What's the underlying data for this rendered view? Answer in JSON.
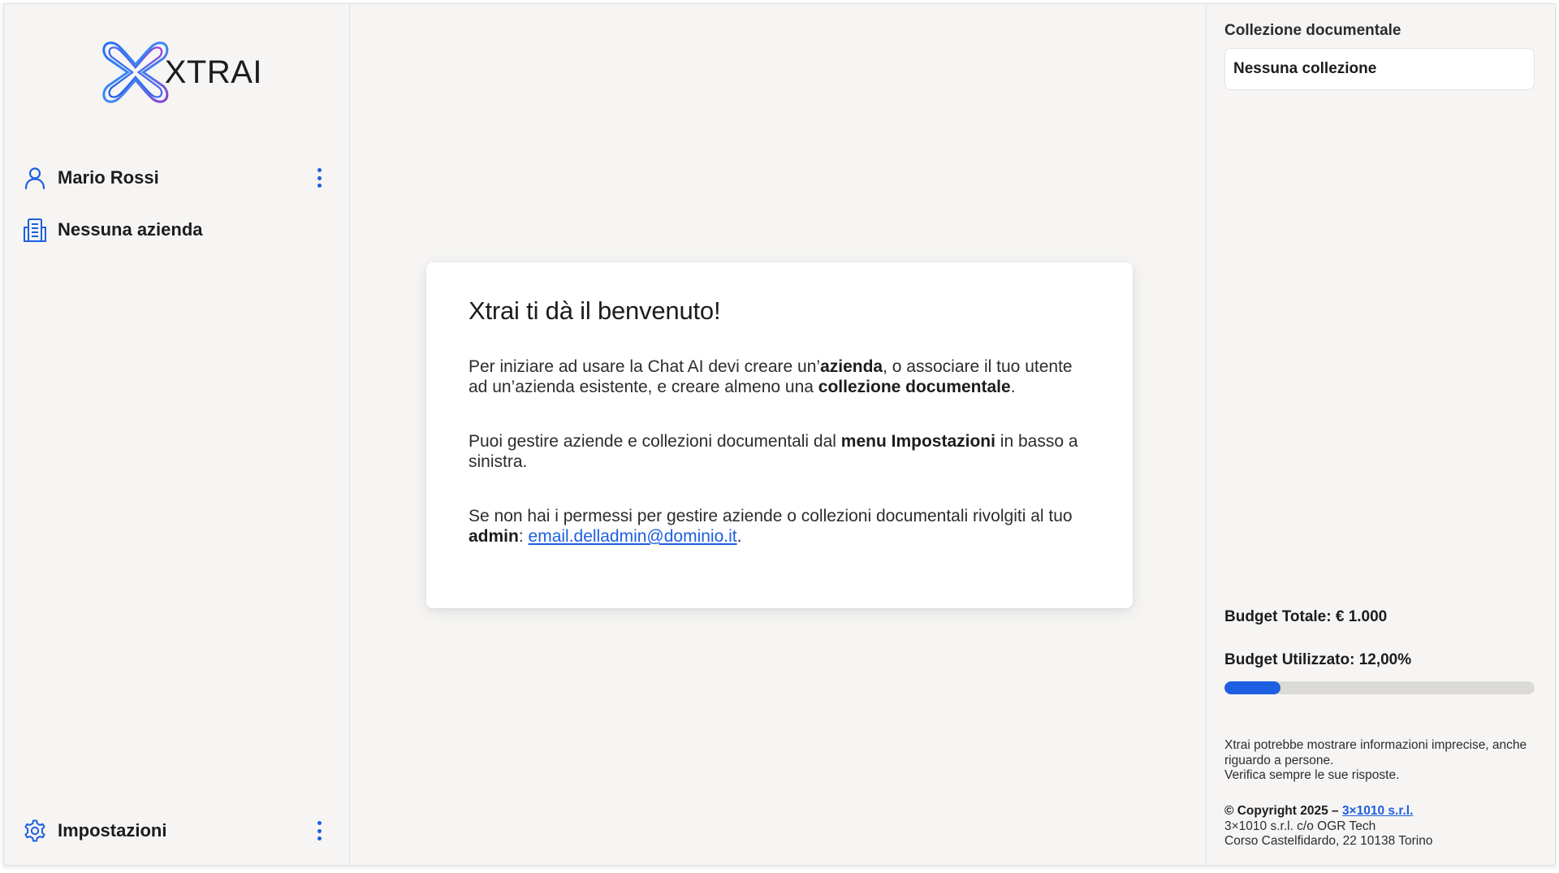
{
  "brand": {
    "logo_text": "XTRAI",
    "accent": "#1d5fe0",
    "logo_gradient": [
      "#2b6ef0",
      "#7a3fd0"
    ]
  },
  "sidebar": {
    "user": {
      "name": "Mario Rossi",
      "icon": "user-icon"
    },
    "company": {
      "name": "Nessuna azienda",
      "icon": "building-icon"
    },
    "settings": {
      "label": "Impostazioni",
      "icon": "gear-icon"
    }
  },
  "welcome": {
    "title": "Xtrai ti dà il benvenuto!",
    "p1_a": "Per iniziare ad usare la Chat AI devi creare un’",
    "p1_b": "azienda",
    "p1_c": ", o associare il tuo utente ad un’azienda esistente, e creare almeno una ",
    "p1_d": "collezione documentale",
    "p1_e": ".",
    "p2_a": "Puoi gestire aziende e collezioni documentali dal ",
    "p2_b": "menu Impostazioni",
    "p2_c": " in basso a sinistra.",
    "p3_a": "Se non hai i permessi per gestire aziende o collezioni documentali rivolgiti al tuo ",
    "p3_b": "admin",
    "p3_c": ": ",
    "p3_link": "email.delladmin@dominio.it",
    "p3_d": "."
  },
  "right_panel": {
    "collection_label": "Collezione documentale",
    "collection_value": "Nessuna collezione",
    "budget_total": "Budget Totale: € 1.000",
    "budget_used": "Budget Utilizzato: 12,00%",
    "budget_used_fraction": 0.18,
    "disclaimer_1": "Xtrai potrebbe mostrare informazioni imprecise, anche riguardo a persone.",
    "disclaimer_2": "Verifica sempre le sue risposte.",
    "copyright_prefix": "© Copyright 2025 – ",
    "copyright_link": "3×1010 s.r.l.",
    "address_1": "3×1010 s.r.l. c/o OGR Tech",
    "address_2": "Corso Castelfidardo, 22 10138 Torino"
  }
}
